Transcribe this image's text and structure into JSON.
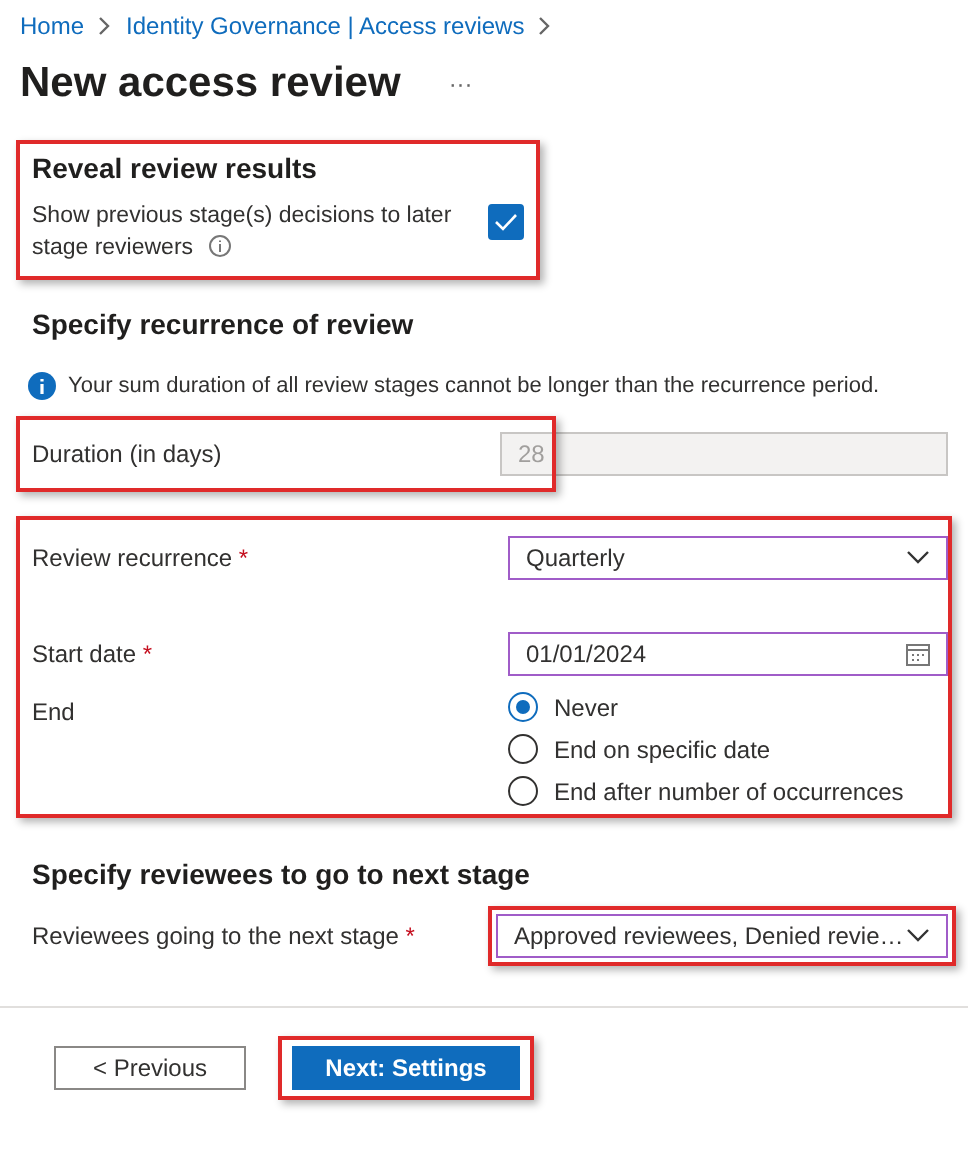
{
  "breadcrumb": [
    {
      "label": "Home"
    },
    {
      "label": "Identity Governance | Access reviews"
    }
  ],
  "title": "New access review",
  "more": "···",
  "reveal": {
    "highlighted": true,
    "heading": "Reveal review results",
    "label": "Show previous stage(s) decisions to later stage reviewers",
    "checked": true
  },
  "recurrence": {
    "heading": "Specify recurrence of review",
    "info": "Your sum duration of all review stages cannot be longer than the recurrence period.",
    "duration": {
      "highlighted": true,
      "label": "Duration (in days)",
      "value": "28",
      "disabled": true
    },
    "schedule": {
      "highlighted": true,
      "recurrence": {
        "label": "Review recurrence",
        "required_mark": "*",
        "value": "Quarterly"
      },
      "start": {
        "label": "Start date",
        "required_mark": "*",
        "value": "01/01/2024"
      },
      "end": {
        "label": "End",
        "options": [
          {
            "label": "Never",
            "selected": true
          },
          {
            "label": "End on specific date",
            "selected": false
          },
          {
            "label": "End after number of occurrences",
            "selected": false
          }
        ]
      }
    }
  },
  "reviewees": {
    "heading": "Specify reviewees to go to next stage",
    "label": "Reviewees going to the next stage",
    "required_mark": "*",
    "value": "Approved reviewees, Denied revie…",
    "highlighted": true
  },
  "buttons": [
    {
      "label": "< Previous",
      "kind": "secondary",
      "highlighted": false
    },
    {
      "label": "Next: Settings",
      "kind": "primary",
      "highlighted": true
    }
  ]
}
